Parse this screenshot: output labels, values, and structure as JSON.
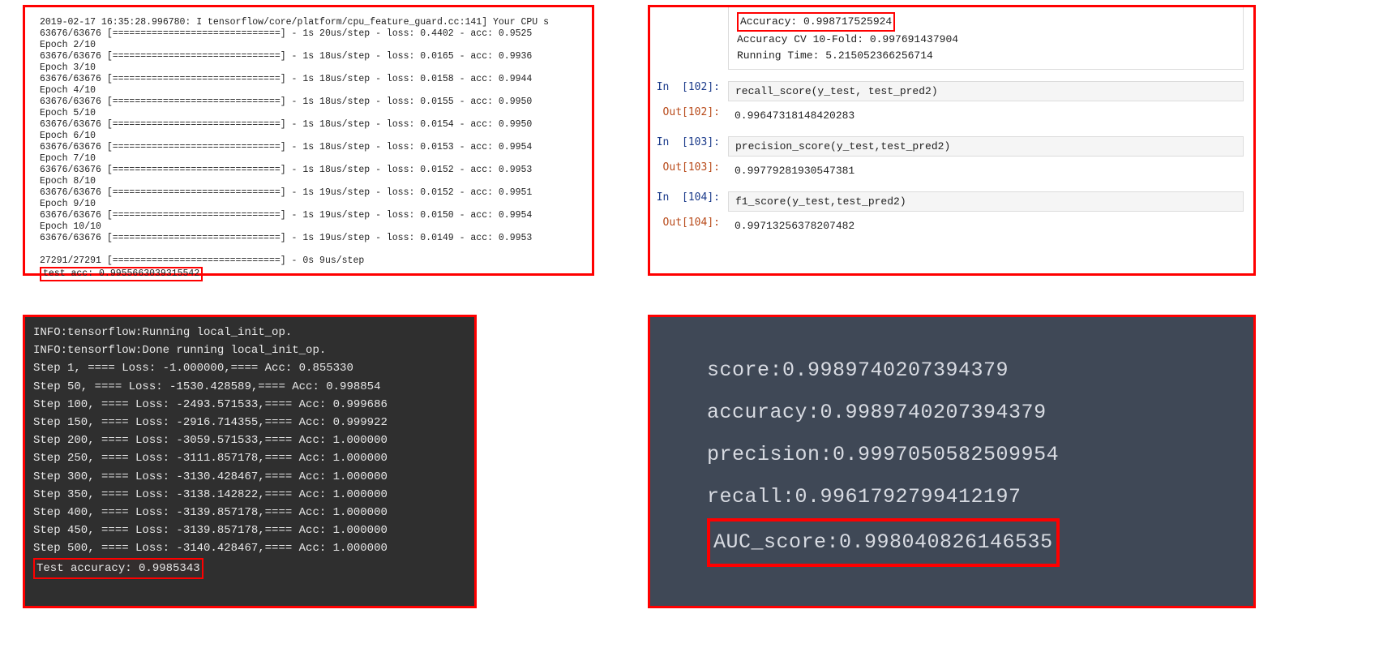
{
  "panelA": {
    "intro": "2019-02-17 16:35:28.996780: I tensorflow/core/platform/cpu_feature_guard.cc:141] Your CPU s",
    "lines": [
      "63676/63676 [==============================] - 1s 20us/step - loss: 0.4402 - acc: 0.9525",
      "Epoch 2/10",
      "63676/63676 [==============================] - 1s 18us/step - loss: 0.0165 - acc: 0.9936",
      "Epoch 3/10",
      "63676/63676 [==============================] - 1s 18us/step - loss: 0.0158 - acc: 0.9944",
      "Epoch 4/10",
      "63676/63676 [==============================] - 1s 18us/step - loss: 0.0155 - acc: 0.9950",
      "Epoch 5/10",
      "63676/63676 [==============================] - 1s 18us/step - loss: 0.0154 - acc: 0.9950",
      "Epoch 6/10",
      "63676/63676 [==============================] - 1s 18us/step - loss: 0.0153 - acc: 0.9954",
      "Epoch 7/10",
      "63676/63676 [==============================] - 1s 18us/step - loss: 0.0152 - acc: 0.9953",
      "Epoch 8/10",
      "63676/63676 [==============================] - 1s 19us/step - loss: 0.0152 - acc: 0.9951",
      "Epoch 9/10",
      "63676/63676 [==============================] - 1s 19us/step - loss: 0.0150 - acc: 0.9954",
      "Epoch 10/10",
      "63676/63676 [==============================] - 1s 19us/step - loss: 0.0149 - acc: 0.9953",
      "",
      "27291/27291 [==============================] - 0s 9us/step"
    ],
    "highlighted": "test acc: 0.9955663039315542"
  },
  "panelB": {
    "top": {
      "accuracy_label": "Accuracy: 0.998717525924",
      "cv_line": "Accuracy CV 10-Fold: 0.997691437904",
      "time_line": "Running Time: 5.215052366256714"
    },
    "cells": [
      {
        "in_num": "102",
        "in_code": "recall_score(y_test, test_pred2)",
        "out_num": "102",
        "out_val": "0.99647318148420283"
      },
      {
        "in_num": "103",
        "in_code": "precision_score(y_test,test_pred2)",
        "out_num": "103",
        "out_val": "0.99779281930547381"
      },
      {
        "in_num": "104",
        "in_code": "f1_score(y_test,test_pred2)",
        "out_num": "104",
        "out_val": "0.99713256378207482"
      }
    ]
  },
  "panelC": {
    "lines": [
      "INFO:tensorflow:Running local_init_op.",
      "INFO:tensorflow:Done running local_init_op.",
      "Step 1, ==== Loss: -1.000000,==== Acc: 0.855330",
      "Step 50, ==== Loss: -1530.428589,==== Acc: 0.998854",
      "Step 100, ==== Loss: -2493.571533,==== Acc: 0.999686",
      "Step 150, ==== Loss: -2916.714355,==== Acc: 0.999922",
      "Step 200, ==== Loss: -3059.571533,==== Acc: 1.000000",
      "Step 250, ==== Loss: -3111.857178,==== Acc: 1.000000",
      "Step 300, ==== Loss: -3130.428467,==== Acc: 1.000000",
      "Step 350, ==== Loss: -3138.142822,==== Acc: 1.000000",
      "Step 400, ==== Loss: -3139.857178,==== Acc: 1.000000",
      "Step 450, ==== Loss: -3139.857178,==== Acc: 1.000000",
      "Step 500, ==== Loss: -3140.428467,==== Acc: 1.000000"
    ],
    "highlighted": "Test accuracy: 0.9985343"
  },
  "panelD": {
    "lines": [
      "score:0.9989740207394379",
      "accuracy:0.9989740207394379",
      "precision:0.9997050582509954",
      "recall:0.9961792799412197"
    ],
    "highlighted": "AUC_score:0.998040826146535"
  }
}
